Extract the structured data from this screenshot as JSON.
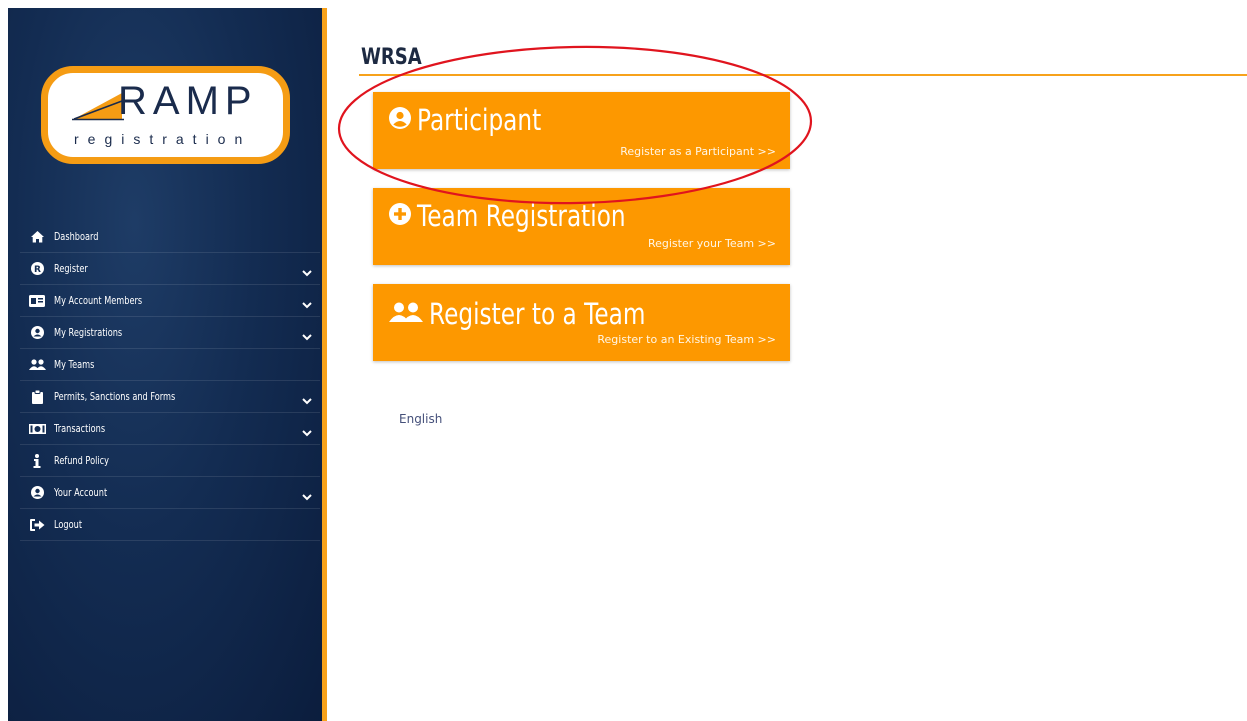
{
  "logo": {
    "brand": "RAMP",
    "sub": "registration"
  },
  "sidebar": {
    "items": [
      {
        "label": "Dashboard",
        "icon": "home-icon",
        "chevron": false
      },
      {
        "label": "Register",
        "icon": "r-circle-icon",
        "chevron": true
      },
      {
        "label": "My Account Members",
        "icon": "id-card-icon",
        "chevron": true
      },
      {
        "label": "My Registrations",
        "icon": "user-circle-icon",
        "chevron": true
      },
      {
        "label": "My Teams",
        "icon": "users-icon",
        "chevron": false
      },
      {
        "label": "Permits, Sanctions and Forms",
        "icon": "clipboard-icon",
        "chevron": true
      },
      {
        "label": "Transactions",
        "icon": "money-bill-icon",
        "chevron": true
      },
      {
        "label": "Refund Policy",
        "icon": "info-icon",
        "chevron": false
      },
      {
        "label": "Your Account",
        "icon": "user-circle-icon",
        "chevron": true
      },
      {
        "label": "Logout",
        "icon": "sign-out-icon",
        "chevron": false
      }
    ]
  },
  "main": {
    "title": "WRSA",
    "cards": [
      {
        "title": "Participant",
        "link": "Register as a Participant >>",
        "icon": "user-circle-icon"
      },
      {
        "title": "Team Registration",
        "link": "Register your Team >>",
        "icon": "plus-circle-icon"
      },
      {
        "title": "Register to a Team",
        "link": "Register to an Existing Team >>",
        "icon": "users-icon"
      }
    ],
    "language": "English"
  },
  "colors": {
    "accent": "#fd9800",
    "sidebar": "#132c52",
    "annotation": "#e0141e"
  }
}
